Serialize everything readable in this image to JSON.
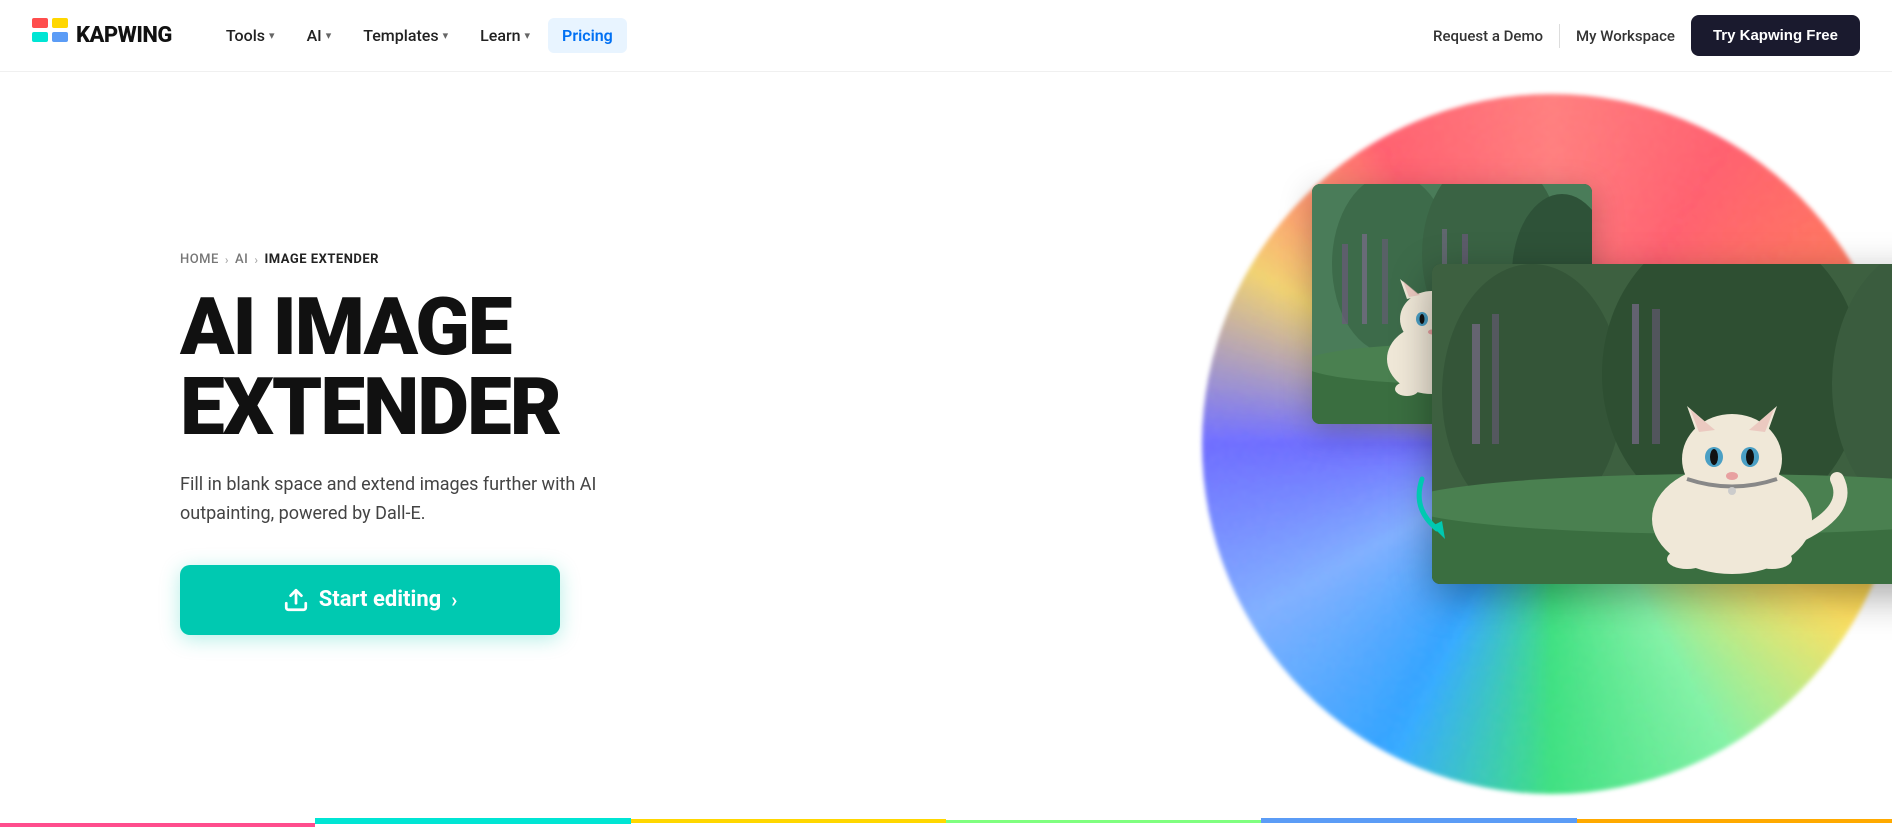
{
  "nav": {
    "logo_text": "KAPWING",
    "links": [
      {
        "label": "Tools",
        "has_dropdown": true
      },
      {
        "label": "AI",
        "has_dropdown": true
      },
      {
        "label": "Templates",
        "has_dropdown": true
      },
      {
        "label": "Learn",
        "has_dropdown": true
      },
      {
        "label": "Pricing",
        "has_dropdown": false,
        "active": true
      }
    ],
    "request_demo": "Request a Demo",
    "my_workspace": "My Workspace",
    "cta": "Try Kapwing Free"
  },
  "breadcrumb": {
    "home": "HOME",
    "ai": "AI",
    "current": "IMAGE EXTENDER"
  },
  "hero": {
    "title_line1": "AI IMAGE",
    "title_line2": "EXTENDER",
    "description": "Fill in blank space and extend images further with AI outpainting, powered by Dall-E.",
    "cta_label": "Start editing",
    "cta_chevron": "›"
  }
}
